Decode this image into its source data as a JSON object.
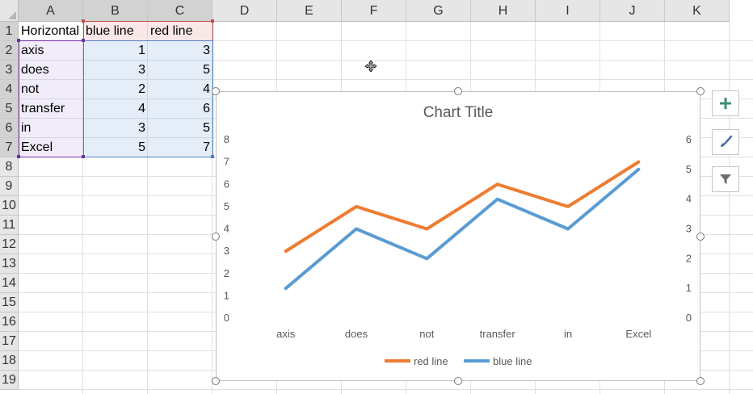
{
  "columns": [
    "A",
    "B",
    "C",
    "D",
    "E",
    "F",
    "G",
    "H",
    "I",
    "J",
    "K"
  ],
  "rows": [
    "1",
    "2",
    "3",
    "4",
    "5",
    "6",
    "7",
    "8",
    "9",
    "10",
    "11",
    "12",
    "13",
    "14",
    "15",
    "16",
    "17",
    "18",
    "19"
  ],
  "cells": {
    "A1": "Horizontal",
    "B1": "blue line",
    "C1": "red line",
    "A2": "axis",
    "B2": "1",
    "C2": "3",
    "A3": "does",
    "B3": "3",
    "C3": "5",
    "A4": "not",
    "B4": "2",
    "C4": "4",
    "A5": "transfer",
    "B5": "4",
    "C5": "6",
    "A6": "in",
    "B6": "3",
    "C6": "5",
    "A7": "Excel",
    "B7": "5",
    "C7": "7"
  },
  "chart_data": {
    "type": "line",
    "title": "Chart Title",
    "categories": [
      "axis",
      "does",
      "not",
      "transfer",
      "in",
      "Excel"
    ],
    "series": [
      {
        "name": "red line",
        "values": [
          3,
          5,
          4,
          6,
          5,
          7
        ],
        "color": "#ED7D31",
        "axis": "primary"
      },
      {
        "name": "blue line",
        "values": [
          1,
          3,
          2,
          4,
          3,
          5
        ],
        "color": "#5B9BD5",
        "axis": "secondary"
      }
    ],
    "y_primary": {
      "min": 0,
      "max": 8,
      "ticks": [
        "0",
        "1",
        "2",
        "3",
        "4",
        "5",
        "6",
        "7",
        "8"
      ]
    },
    "y_secondary": {
      "min": 0,
      "max": 6,
      "ticks": [
        "0",
        "1",
        "2",
        "3",
        "4",
        "5",
        "6"
      ]
    },
    "legend": "bottom",
    "legend_order": [
      "red line",
      "blue line"
    ],
    "grid": false
  },
  "side_buttons": [
    "plus-icon",
    "brush-icon",
    "filter-icon"
  ],
  "colors": {
    "selection_purple": "#7030a0",
    "selection_red": "#c0504d",
    "selection_blue": "#4f81bd"
  }
}
